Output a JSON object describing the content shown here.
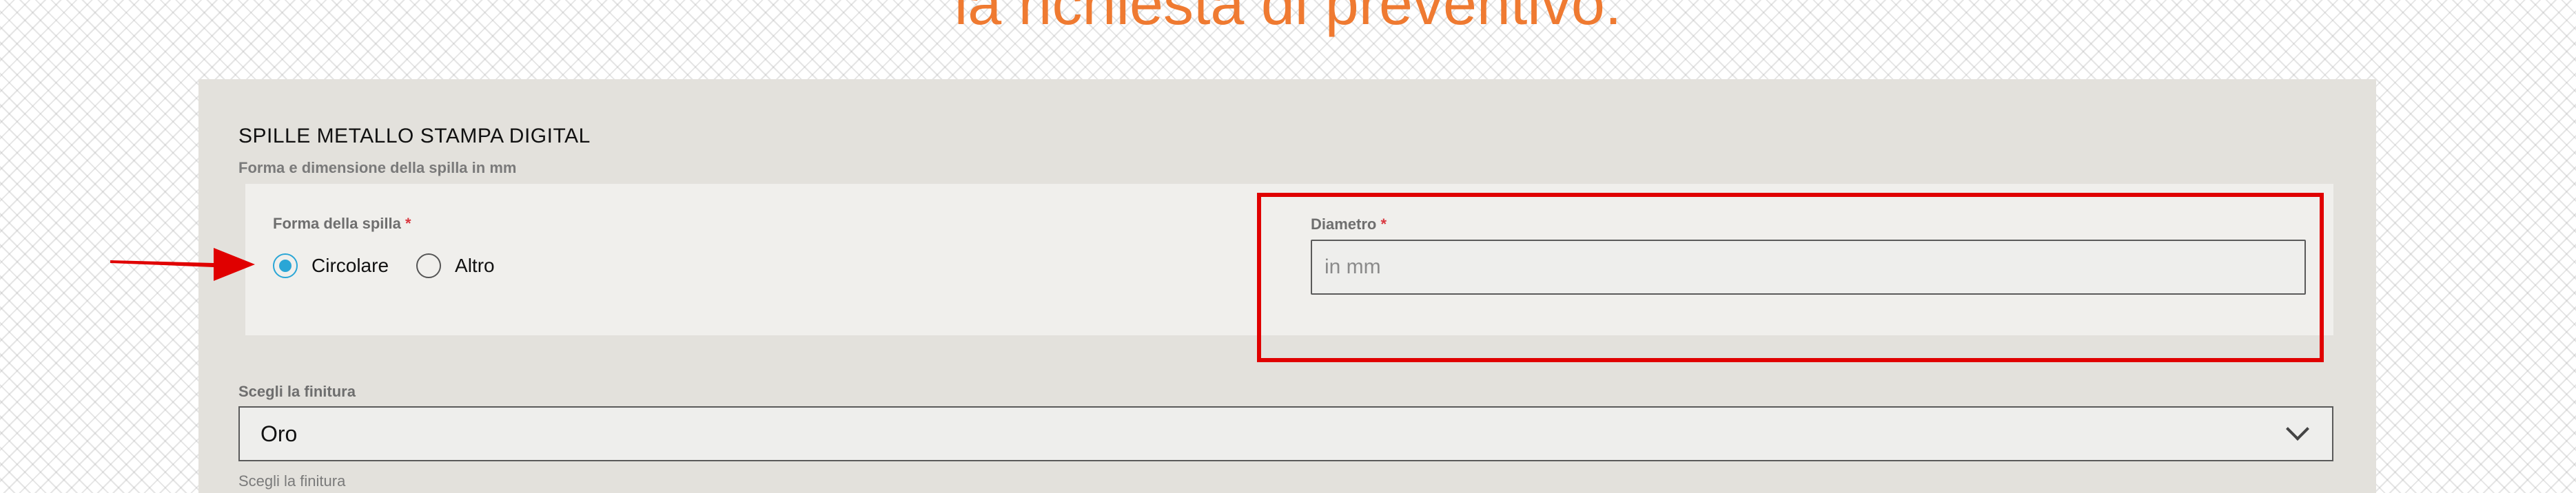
{
  "page": {
    "heading": "la richiesta di preventivo:"
  },
  "form": {
    "section_title": "SPILLE METALLO STAMPA DIGITAL",
    "section_subtitle": "Forma e dimensione della spilla in mm",
    "shape_field": {
      "label": "Forma della spilla",
      "required_mark": "*",
      "options": [
        {
          "label": "Circolare",
          "selected": true
        },
        {
          "label": "Altro",
          "selected": false
        }
      ]
    },
    "diameter_field": {
      "label": "Diametro",
      "required_mark": "*",
      "value": "",
      "placeholder": "in mm"
    },
    "finish_field": {
      "label": "Scegli la finitura",
      "selected_value": "Oro",
      "help_text": "Scegli la finitura"
    }
  },
  "colors": {
    "heading": "#ef7a31",
    "radio_selected": "#2aa6d6",
    "required": "#d9373f",
    "annotation": "#e00000",
    "panel_bg": "#e3e1dc",
    "inner_box_bg": "#f0efec"
  },
  "icons": {
    "select_chevron": "chevron-down-icon",
    "annotation_arrow": "arrow-right-icon"
  }
}
